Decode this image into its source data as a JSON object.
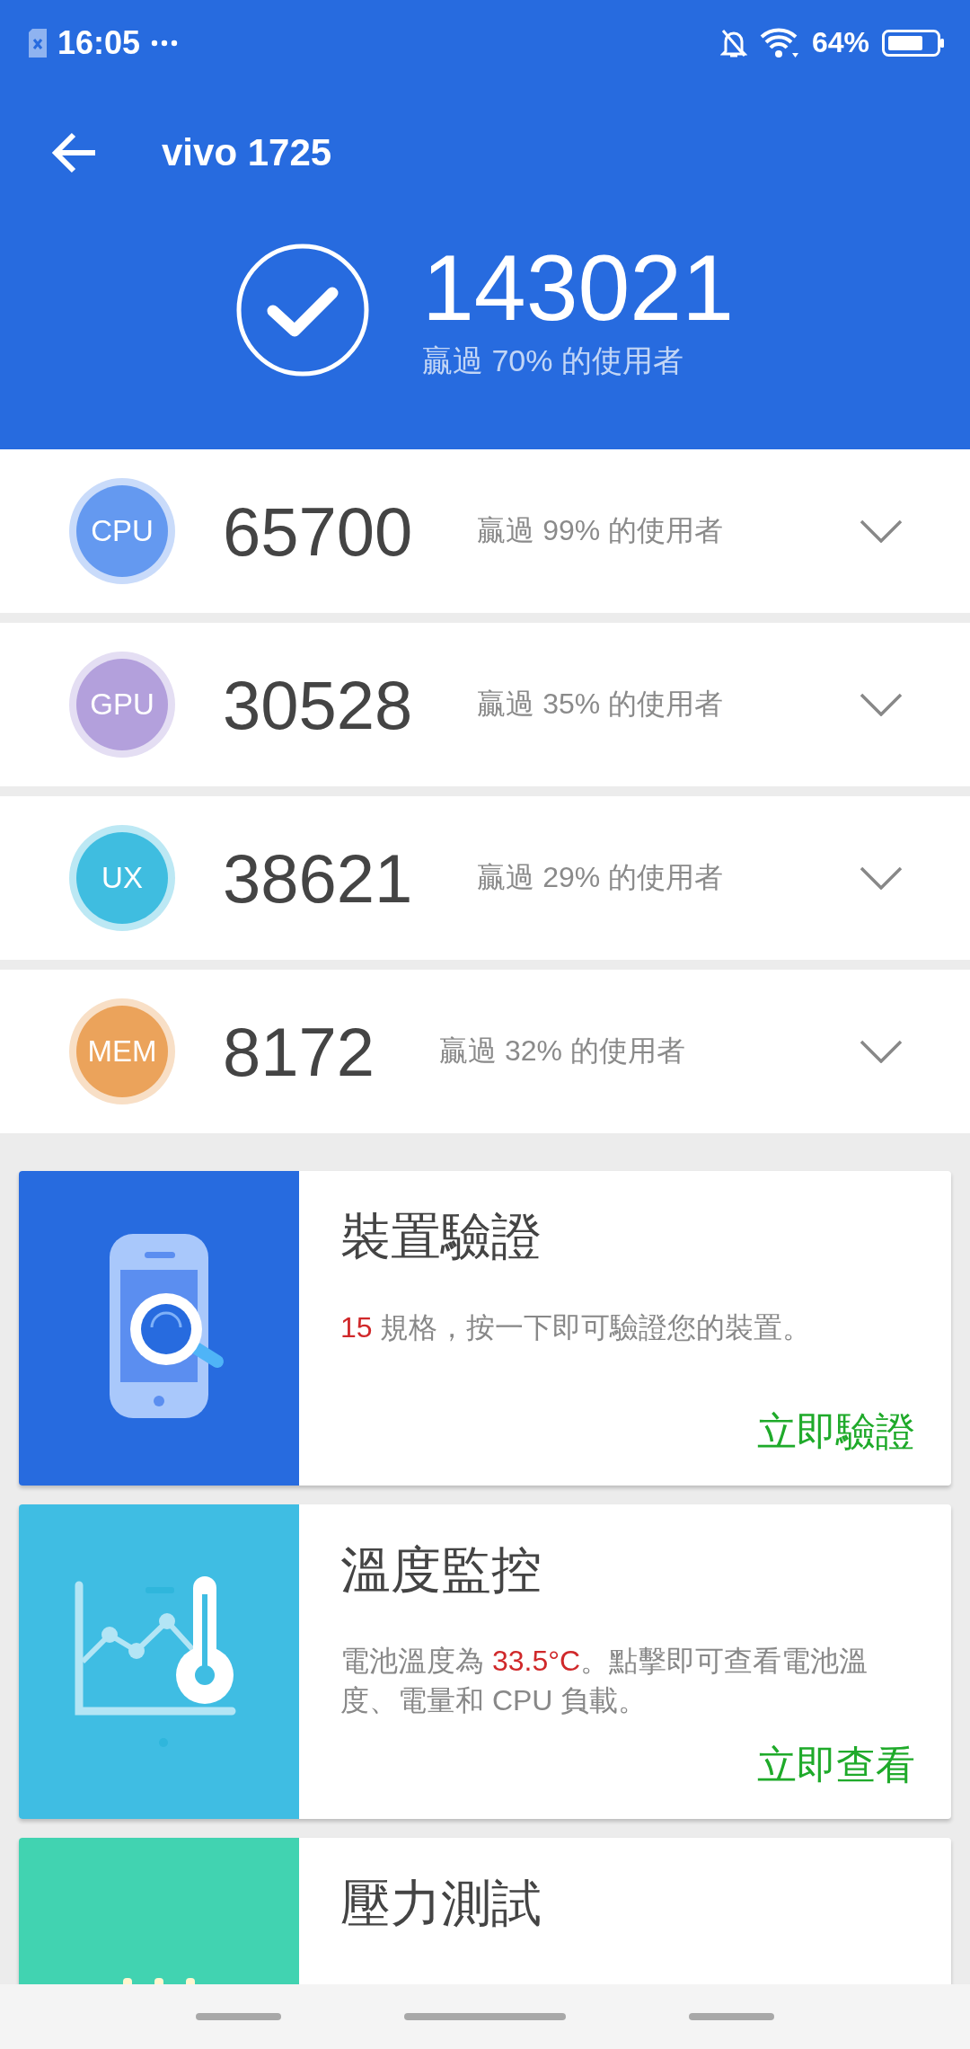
{
  "status_bar": {
    "time": "16:05",
    "battery": "64%"
  },
  "header": {
    "title": "vivo 1725",
    "total_score": "143021",
    "percentile": "贏過 70% 的使用者"
  },
  "scores": [
    {
      "label": "CPU",
      "color": "#6499f0",
      "score": "65700",
      "percentile": "贏過 99% 的使用者"
    },
    {
      "label": "GPU",
      "color": "#b3a0dc",
      "score": "30528",
      "percentile": "贏過 35% 的使用者"
    },
    {
      "label": "UX",
      "color": "#3fbde0",
      "score": "38621",
      "percentile": "贏過 29% 的使用者"
    },
    {
      "label": "MEM",
      "color": "#eba35b",
      "score": "8172",
      "percentile": "贏過 32% 的使用者"
    }
  ],
  "cards": [
    {
      "kind": "device",
      "color": "#276bdf",
      "title": "裝置驗證",
      "description": [
        {
          "text": "15",
          "highlight": true
        },
        {
          "text": " 規格，按一下即可驗證您的裝置。",
          "highlight": false
        }
      ],
      "action": "立即驗證"
    },
    {
      "kind": "temperature",
      "color": "#3fbde3",
      "title": "溫度監控",
      "description": [
        {
          "text": "電池溫度為 ",
          "highlight": false
        },
        {
          "text": "33.5°C",
          "highlight": true
        },
        {
          "text": "。點擊即可查看電池溫度、電量和 CPU 負載。",
          "highlight": false
        }
      ],
      "action": "立即查看"
    },
    {
      "kind": "stress",
      "color": "#41d3b1",
      "title": "壓力測試"
    }
  ]
}
